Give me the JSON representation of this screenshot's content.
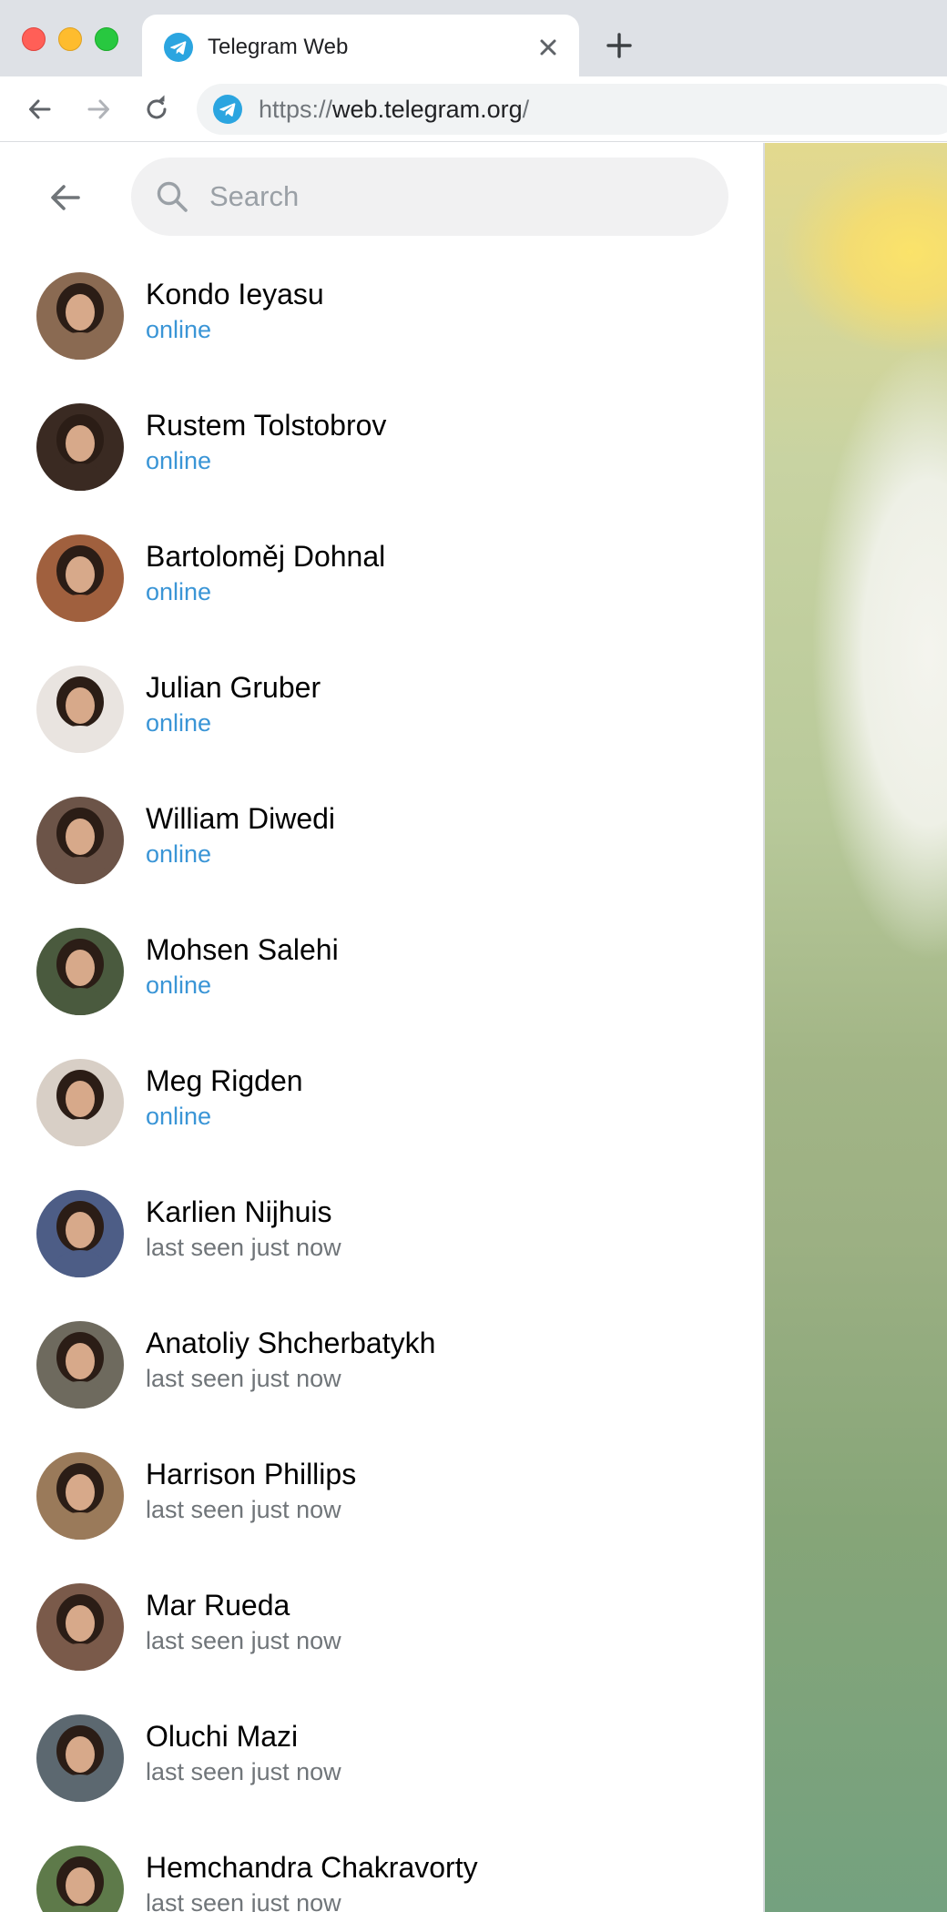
{
  "browser": {
    "tab_title": "Telegram Web",
    "url_scheme": "https://",
    "url_host": "web.telegram.org",
    "url_path": "/"
  },
  "colors": {
    "accent": "#3a95d6",
    "status_muted": "#707579",
    "search_bg": "#f1f1f2"
  },
  "icons": {
    "tab_favicon": "telegram-icon",
    "tab_close": "close-icon",
    "new_tab": "plus-icon",
    "back": "arrow-left-icon",
    "forward": "arrow-right-icon",
    "reload": "reload-icon",
    "search": "search-icon"
  },
  "search": {
    "placeholder": "Search",
    "value": ""
  },
  "contacts": [
    {
      "name": "Kondo Ieyasu",
      "status": "online",
      "online": true,
      "avatar_color": "#8a6a52"
    },
    {
      "name": "Rustem Tolstobrov",
      "status": "online",
      "online": true,
      "avatar_color": "#3a2a22"
    },
    {
      "name": "Bartoloměj Dohnal",
      "status": "online",
      "online": true,
      "avatar_color": "#a0603e"
    },
    {
      "name": "Julian Gruber",
      "status": "online",
      "online": true,
      "avatar_color": "#e9e4e0"
    },
    {
      "name": "William Diwedi",
      "status": "online",
      "online": true,
      "avatar_color": "#6c5448"
    },
    {
      "name": "Mohsen Salehi",
      "status": "online",
      "online": true,
      "avatar_color": "#4a5a3e"
    },
    {
      "name": "Meg Rigden",
      "status": "online",
      "online": true,
      "avatar_color": "#d8cfc6"
    },
    {
      "name": "Karlien Nijhuis",
      "status": "last seen just now",
      "online": false,
      "avatar_color": "#4d5d86"
    },
    {
      "name": "Anatoliy Shcherbatykh",
      "status": "last seen just now",
      "online": false,
      "avatar_color": "#6e6a5e"
    },
    {
      "name": "Harrison Phillips",
      "status": "last seen just now",
      "online": false,
      "avatar_color": "#9a7a5a"
    },
    {
      "name": "Mar Rueda",
      "status": "last seen just now",
      "online": false,
      "avatar_color": "#7a5a4a"
    },
    {
      "name": "Oluchi Mazi",
      "status": "last seen just now",
      "online": false,
      "avatar_color": "#5c6870"
    },
    {
      "name": "Hemchandra Chakravorty",
      "status": "last seen just now",
      "online": false,
      "avatar_color": "#5e7a4a"
    }
  ]
}
